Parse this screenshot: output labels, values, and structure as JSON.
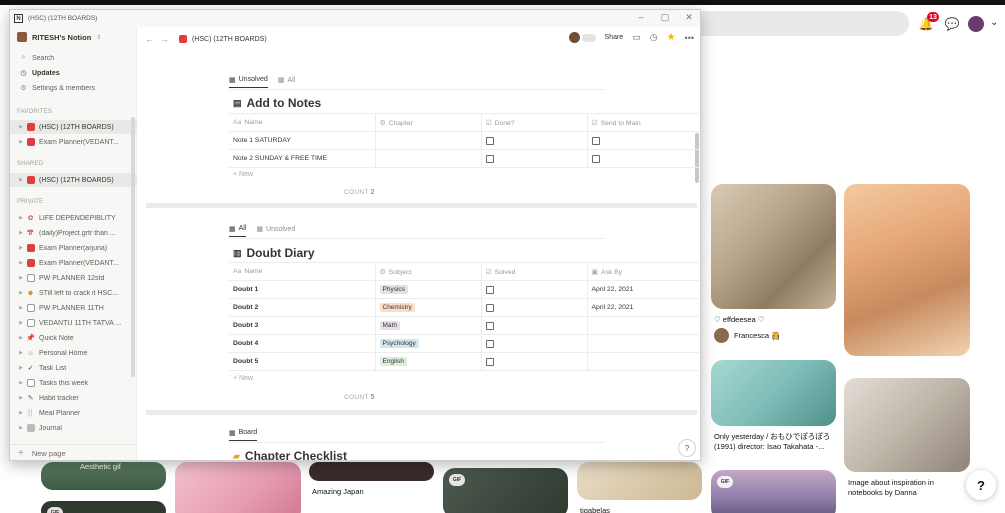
{
  "window": {
    "title": "(HSC) (12TH BOARDS)"
  },
  "sidebar": {
    "workspace": "RITESH's Notion",
    "top": [
      {
        "icon": "search-icon",
        "label": "Search"
      },
      {
        "icon": "clock-icon",
        "label": "Updates"
      },
      {
        "icon": "gear-icon",
        "label": "Settings & members"
      }
    ],
    "favorites_label": "FAVORITES",
    "favorites": [
      {
        "label": "(HSC) (12TH BOARDS)"
      },
      {
        "label": "Exam Planner(VEDANT..."
      }
    ],
    "shared_label": "SHARED",
    "shared": [
      {
        "label": "(HSC) (12TH BOARDS)"
      }
    ],
    "private_label": "PRIVATE",
    "private": [
      {
        "label": "LIFE DEPENDEPIBLITY",
        "glyph": "✿"
      },
      {
        "label": "(daily)Project.grtr than ...",
        "glyph": "📅"
      },
      {
        "label": "Exam Planner(arjuna)",
        "glyph": ""
      },
      {
        "label": "Exam Planner(VEDANT...",
        "glyph": ""
      },
      {
        "label": "PW PLANNER 12std",
        "glyph": ""
      },
      {
        "label": "STill left to crack it HSC...",
        "glyph": "☻"
      },
      {
        "label": "PW PLANNER 11TH",
        "glyph": ""
      },
      {
        "label": "VEDANTU 11TH TATVA ...",
        "glyph": ""
      },
      {
        "label": "Quick Note",
        "glyph": "📌"
      },
      {
        "label": "Personal Home",
        "glyph": "🏠"
      },
      {
        "label": "Task List",
        "glyph": "✓"
      },
      {
        "label": "Tasks this week",
        "glyph": ""
      },
      {
        "label": "Habit tracker",
        "glyph": "✎"
      },
      {
        "label": "Meal Planner",
        "glyph": "🍴"
      },
      {
        "label": "Journal",
        "glyph": "📓"
      }
    ],
    "new_page": "New page"
  },
  "topbar": {
    "breadcrumb": "(HSC) (12TH BOARDS)",
    "share": "Share"
  },
  "notes": {
    "tabs": [
      "Unsolved",
      "All"
    ],
    "title": "Add to Notes",
    "columns": [
      "Name",
      "Chapter",
      "Done?",
      "Send to Main"
    ],
    "rows": [
      {
        "name": "Note 1 SATURDAY",
        "chapter": "",
        "done": false,
        "send": false
      },
      {
        "name": "Note 2 SUNDAY & FREE TIME",
        "chapter": "",
        "done": false,
        "send": false
      }
    ],
    "new_label": "New",
    "count_label": "COUNT",
    "count": "2"
  },
  "doubts": {
    "tabs": [
      "All",
      "Unsolved"
    ],
    "title": "Doubt Diary",
    "columns": [
      "Name",
      "Subject",
      "Solved",
      "Ask By"
    ],
    "rows": [
      {
        "name": "Doubt 1",
        "subject": "Physics",
        "color": "#e3e2e0",
        "solved": false,
        "ask": "April 22, 2021"
      },
      {
        "name": "Doubt 2",
        "subject": "Chemistry",
        "color": "#fadec9",
        "solved": false,
        "ask": "April 22, 2021"
      },
      {
        "name": "Doubt 3",
        "subject": "Math",
        "color": "#e8deee",
        "solved": false,
        "ask": ""
      },
      {
        "name": "Doubt 4",
        "subject": "Psychology",
        "color": "#d3e5ef",
        "solved": false,
        "ask": ""
      },
      {
        "name": "Doubt 5",
        "subject": "English",
        "color": "#dbeddb",
        "solved": false,
        "ask": ""
      }
    ],
    "new_label": "New",
    "count_label": "COUNT",
    "count": "5"
  },
  "checklist": {
    "tab": "Board",
    "title": "Chapter Checklist"
  },
  "help": "?",
  "background": {
    "notifications": "13",
    "pins": [
      {
        "caption": "♡ effdeesea ♡"
      },
      {
        "user": "Francesca 👸"
      },
      {
        "caption": "Only yesterday / おもひでぽろぽろ (1991) director: Isao Takahata -..."
      },
      {
        "caption": "Image about inspiration in notebooks by Danna"
      },
      {
        "caption": "Aesthetic gif"
      },
      {
        "caption": "Amazing Japan"
      },
      {
        "caption": "tigabelas"
      }
    ],
    "help": "?"
  }
}
